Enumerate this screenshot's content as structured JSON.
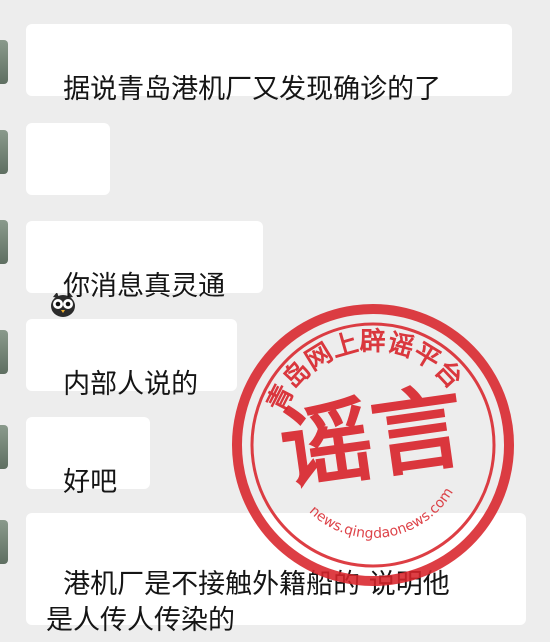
{
  "messages": [
    {
      "text": "据说青岛港机厂又发现确诊的了"
    },
    {
      "emoji": "owl-emoji"
    },
    {
      "text": "你消息真灵通"
    },
    {
      "text": "内部人说的"
    },
    {
      "text": "好吧"
    },
    {
      "text": "港机厂是不接触外籍船的 说明他\n是人传人传染的"
    }
  ],
  "stamp": {
    "ring_text": "青岛网上辟谣平台",
    "center_text": "谣言",
    "url_text": "news.qingdaonews.com",
    "color": "#d8232a"
  }
}
